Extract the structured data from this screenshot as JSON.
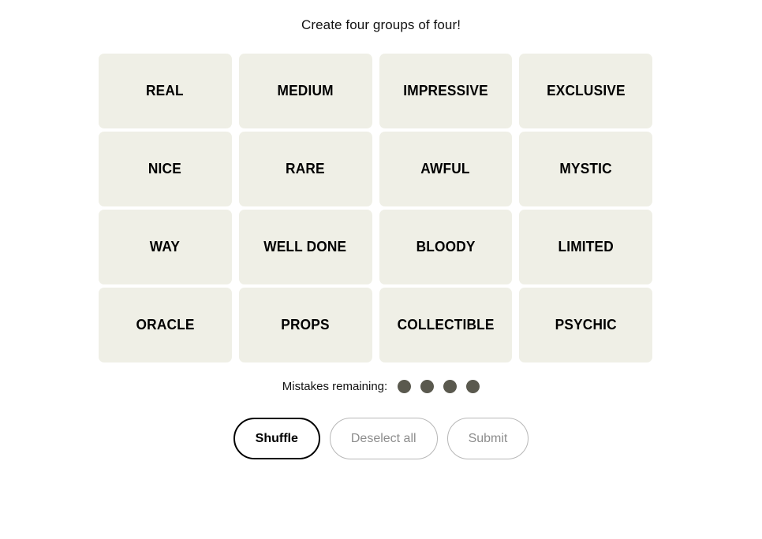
{
  "title": "Create four groups of four!",
  "board": {
    "rows": [
      [
        "REAL",
        "MEDIUM",
        "IMPRESSIVE",
        "EXCLUSIVE"
      ],
      [
        "NICE",
        "RARE",
        "AWFUL",
        "MYSTIC"
      ],
      [
        "WAY",
        "WELL DONE",
        "BLOODY",
        "LIMITED"
      ],
      [
        "ORACLE",
        "PROPS",
        "COLLECTIBLE",
        "PSYCHIC"
      ]
    ],
    "tile_color": "#efefe6",
    "tile_text_color": "#000000"
  },
  "mistakes": {
    "label": "Mistakes remaining:",
    "remaining": 4,
    "dot_color": "#5a594e"
  },
  "buttons": {
    "shuffle": {
      "label": "Shuffle",
      "state": "active"
    },
    "deselect": {
      "label": "Deselect all",
      "state": "disabled"
    },
    "submit": {
      "label": "Submit",
      "state": "disabled"
    }
  },
  "colors": {
    "page_background": "#ffffff",
    "active_border": "#000000",
    "disabled_border": "#b7b7b7",
    "disabled_text": "#8d8d8d"
  }
}
